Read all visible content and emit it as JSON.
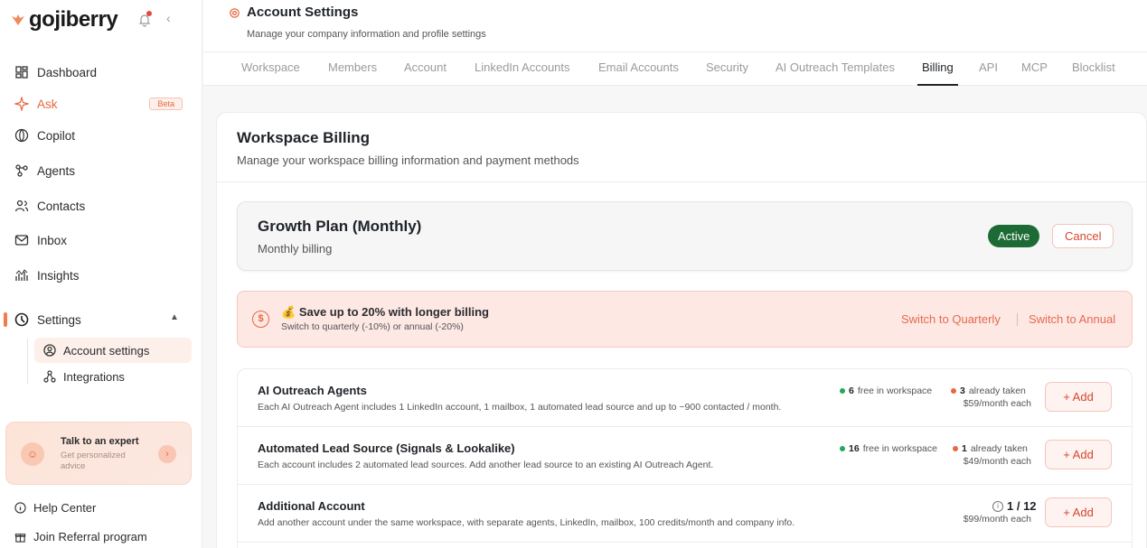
{
  "brand": {
    "name": "gojiberry",
    "accent": "#e8683f"
  },
  "sidebar": {
    "nav": [
      {
        "label": "Dashboard",
        "icon": "dashboard-icon"
      },
      {
        "label": "Ask",
        "icon": "sparkle-icon",
        "badge": "Beta"
      },
      {
        "label": "Copilot",
        "icon": "copilot-icon"
      },
      {
        "label": "Agents",
        "icon": "agents-icon"
      },
      {
        "label": "Contacts",
        "icon": "contacts-icon"
      },
      {
        "label": "Inbox",
        "icon": "inbox-icon"
      },
      {
        "label": "Insights",
        "icon": "insights-icon"
      },
      {
        "label": "Settings",
        "icon": "settings-icon"
      }
    ],
    "subnav": [
      {
        "label": "Account settings",
        "icon": "user-circle-icon",
        "active": true
      },
      {
        "label": "Integrations",
        "icon": "integrations-icon"
      }
    ],
    "expert": {
      "title": "Talk to an expert",
      "subtitle": "Get personalized advice"
    },
    "footer": [
      {
        "label": "Help Center",
        "icon": "info-icon"
      },
      {
        "label": "Join Referral program",
        "icon": "gift-icon"
      }
    ]
  },
  "header": {
    "title": "Account Settings",
    "subtitle": "Manage your company information and profile settings"
  },
  "tabs": [
    "Workspace",
    "Members",
    "Account",
    "LinkedIn Accounts",
    "Email Accounts",
    "Security",
    "AI Outreach Templates",
    "Billing",
    "API",
    "MCP",
    "Blocklist"
  ],
  "active_tab": "Billing",
  "billing": {
    "title": "Workspace Billing",
    "subtitle": "Manage your workspace billing information and payment methods",
    "plan": {
      "name": "Growth Plan (Monthly)",
      "cycle": "Monthly billing",
      "status": "Active",
      "cancel_label": "Cancel"
    },
    "promo": {
      "emoji": "💰",
      "title": "Save up to 20% with longer billing",
      "subtitle": "Switch to quarterly (-10%) or annual (-20%)",
      "quarterly_label": "Switch to Quarterly",
      "annual_label": "Switch to Annual"
    },
    "items": [
      {
        "title": "AI Outreach Agents",
        "description": "Each AI Outreach Agent includes 1 LinkedIn account, 1 mailbox, 1 automated lead source and up to ~900 contacted / month.",
        "free_count": "6",
        "free_label": "free in workspace",
        "taken_count": "3",
        "taken_label": "already taken",
        "price": "$59/month each",
        "add_label": "+ Add"
      },
      {
        "title": "Automated Lead Source (Signals & Lookalike)",
        "description": "Each account includes 2 automated lead sources. Add another lead source to an existing AI Outreach Agent.",
        "free_count": "16",
        "free_label": "free in workspace",
        "taken_count": "1",
        "taken_label": "already taken",
        "price": "$49/month each",
        "add_label": "+ Add"
      },
      {
        "title": "Additional Account",
        "description": "Add another account under the same workspace, with separate agents, LinkedIn, mailbox, 100 credits/month and company info.",
        "usage": "1 / 12",
        "price": "$99/month each",
        "add_label": "+ Add"
      }
    ]
  }
}
